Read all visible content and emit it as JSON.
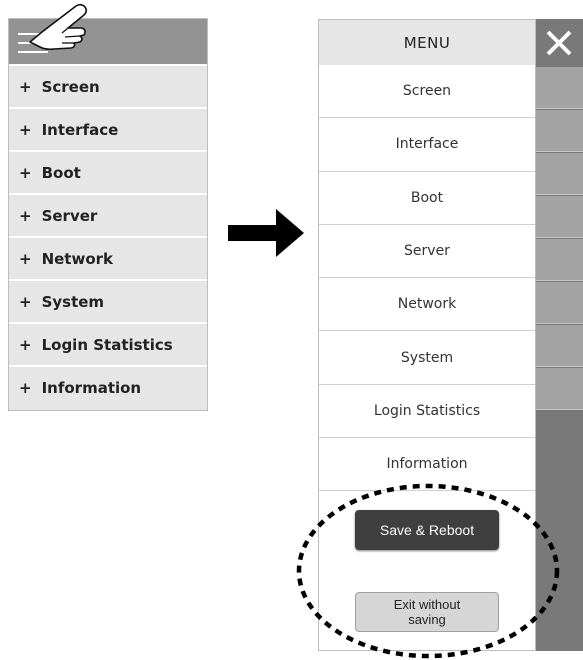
{
  "left_menu": {
    "items": [
      {
        "prefix": "+",
        "label": "Screen"
      },
      {
        "prefix": "+",
        "label": "Interface"
      },
      {
        "prefix": "+",
        "label": "Boot"
      },
      {
        "prefix": "+",
        "label": "Server"
      },
      {
        "prefix": "+",
        "label": "Network"
      },
      {
        "prefix": "+",
        "label": "System"
      },
      {
        "prefix": "+",
        "label": "Login Statistics"
      },
      {
        "prefix": "+",
        "label": "Information"
      }
    ]
  },
  "right_menu": {
    "title": "MENU",
    "items": [
      "Screen",
      "Interface",
      "Boot",
      "Server",
      "Network",
      "System",
      "Login Statistics",
      "Information"
    ],
    "save_label": "Save & Reboot",
    "exit_label": "Exit without\nsaving"
  },
  "icons": [
    "hamburger-icon",
    "pointing-hand-icon",
    "right-arrow-icon",
    "close-icon"
  ],
  "colors": {
    "topbar": "#939393",
    "menu_bg": "#e6e6e6",
    "overlay": "#797979",
    "save_button": "#3f3f3f",
    "exit_button": "#d6d6d6"
  }
}
